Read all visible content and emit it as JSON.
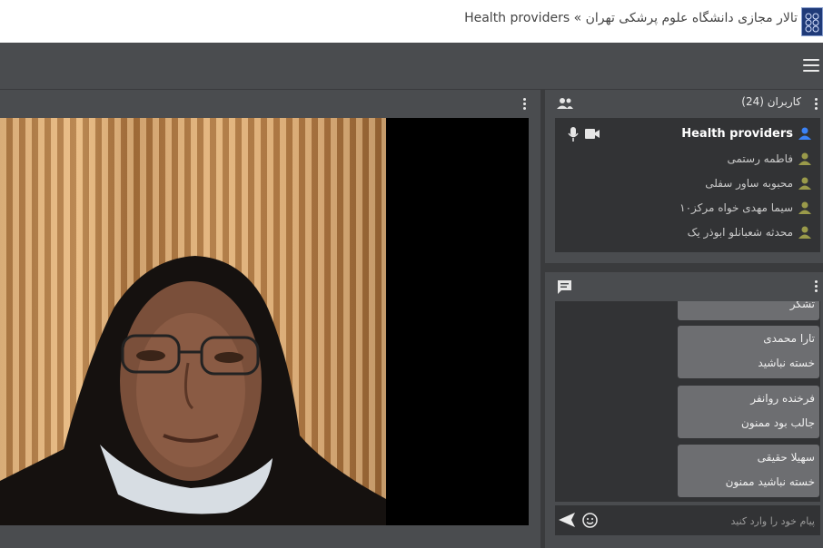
{
  "header": {
    "title": "تالار مجازی دانشگاه علوم پرشکی تهران » Health providers"
  },
  "users": {
    "title": "کاربران (24)",
    "current_user": "Health providers",
    "list": [
      "فاطمه رستمی",
      "محبوبه ساور سفلی",
      "سیما مهدی خواه مرکز۱۰",
      "محدثه شعبانلو ابوذر یک"
    ]
  },
  "chat": {
    "partial_text": "تشکر",
    "messages": [
      {
        "sender": "تارا محمدی",
        "text": "خسته نباشید"
      },
      {
        "sender": "فرخنده روانفر",
        "text": "جالب بود ممنون"
      },
      {
        "sender": "سهیلا حقیقی",
        "text": "خسته نباشید ممنون"
      }
    ],
    "input_placeholder": "پیام خود را وارد کنید"
  },
  "icons": {
    "menu": "hamburger-menu-icon",
    "users": "users-group-icon",
    "chat": "chat-bubble-icon",
    "mic": "microphone-icon",
    "camera": "video-camera-icon",
    "send": "send-icon",
    "emoji": "emoji-icon"
  },
  "colors": {
    "accent_blue": "#3b82f6",
    "user_olive": "#9a9a4a",
    "panel": "#4a4c4f",
    "background": "#3a3b3d"
  }
}
